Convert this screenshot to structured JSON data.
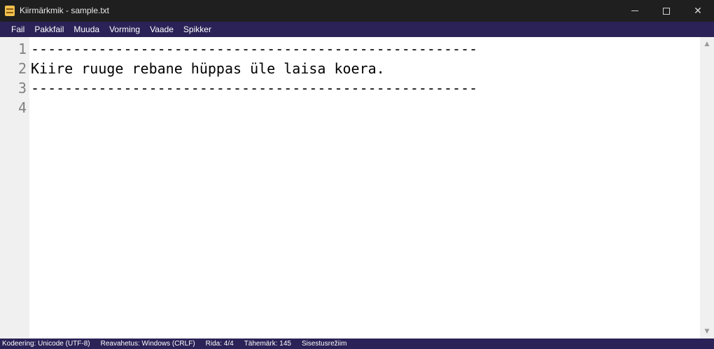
{
  "window": {
    "title": "Kiirmärkmik - sample.txt",
    "icon": "notepad-icon",
    "controls": {
      "minimize": "minimize-icon",
      "maximize": "maximize-icon",
      "close": "✕"
    }
  },
  "menu": {
    "items": [
      "Fail",
      "Pakkfail",
      "Muuda",
      "Vorming",
      "Vaade",
      "Spikker"
    ]
  },
  "editor": {
    "lines": [
      {
        "number": "1",
        "text": "-----------------------------------------------------"
      },
      {
        "number": "2",
        "text": "Kiire ruuge rebane hüppas üle laisa koera."
      },
      {
        "number": "3",
        "text": "-----------------------------------------------------"
      },
      {
        "number": "4",
        "text": ""
      }
    ],
    "scroll": {
      "up": "▲",
      "down": "▼"
    }
  },
  "status": {
    "encoding": "Kodeering: Unicode (UTF-8)",
    "line_endings": "Reavahetus: Windows (CRLF)",
    "row": "Rida: 4/4",
    "chars": "Tähemärk: 145",
    "mode": "Sisestusrežiim"
  },
  "colors": {
    "titlebar": "#1f1f1f",
    "menubar": "#2b2257",
    "statusbar": "#2b2257",
    "editor_bg": "#ffffff",
    "gutter_bg": "#f0f0f0"
  }
}
